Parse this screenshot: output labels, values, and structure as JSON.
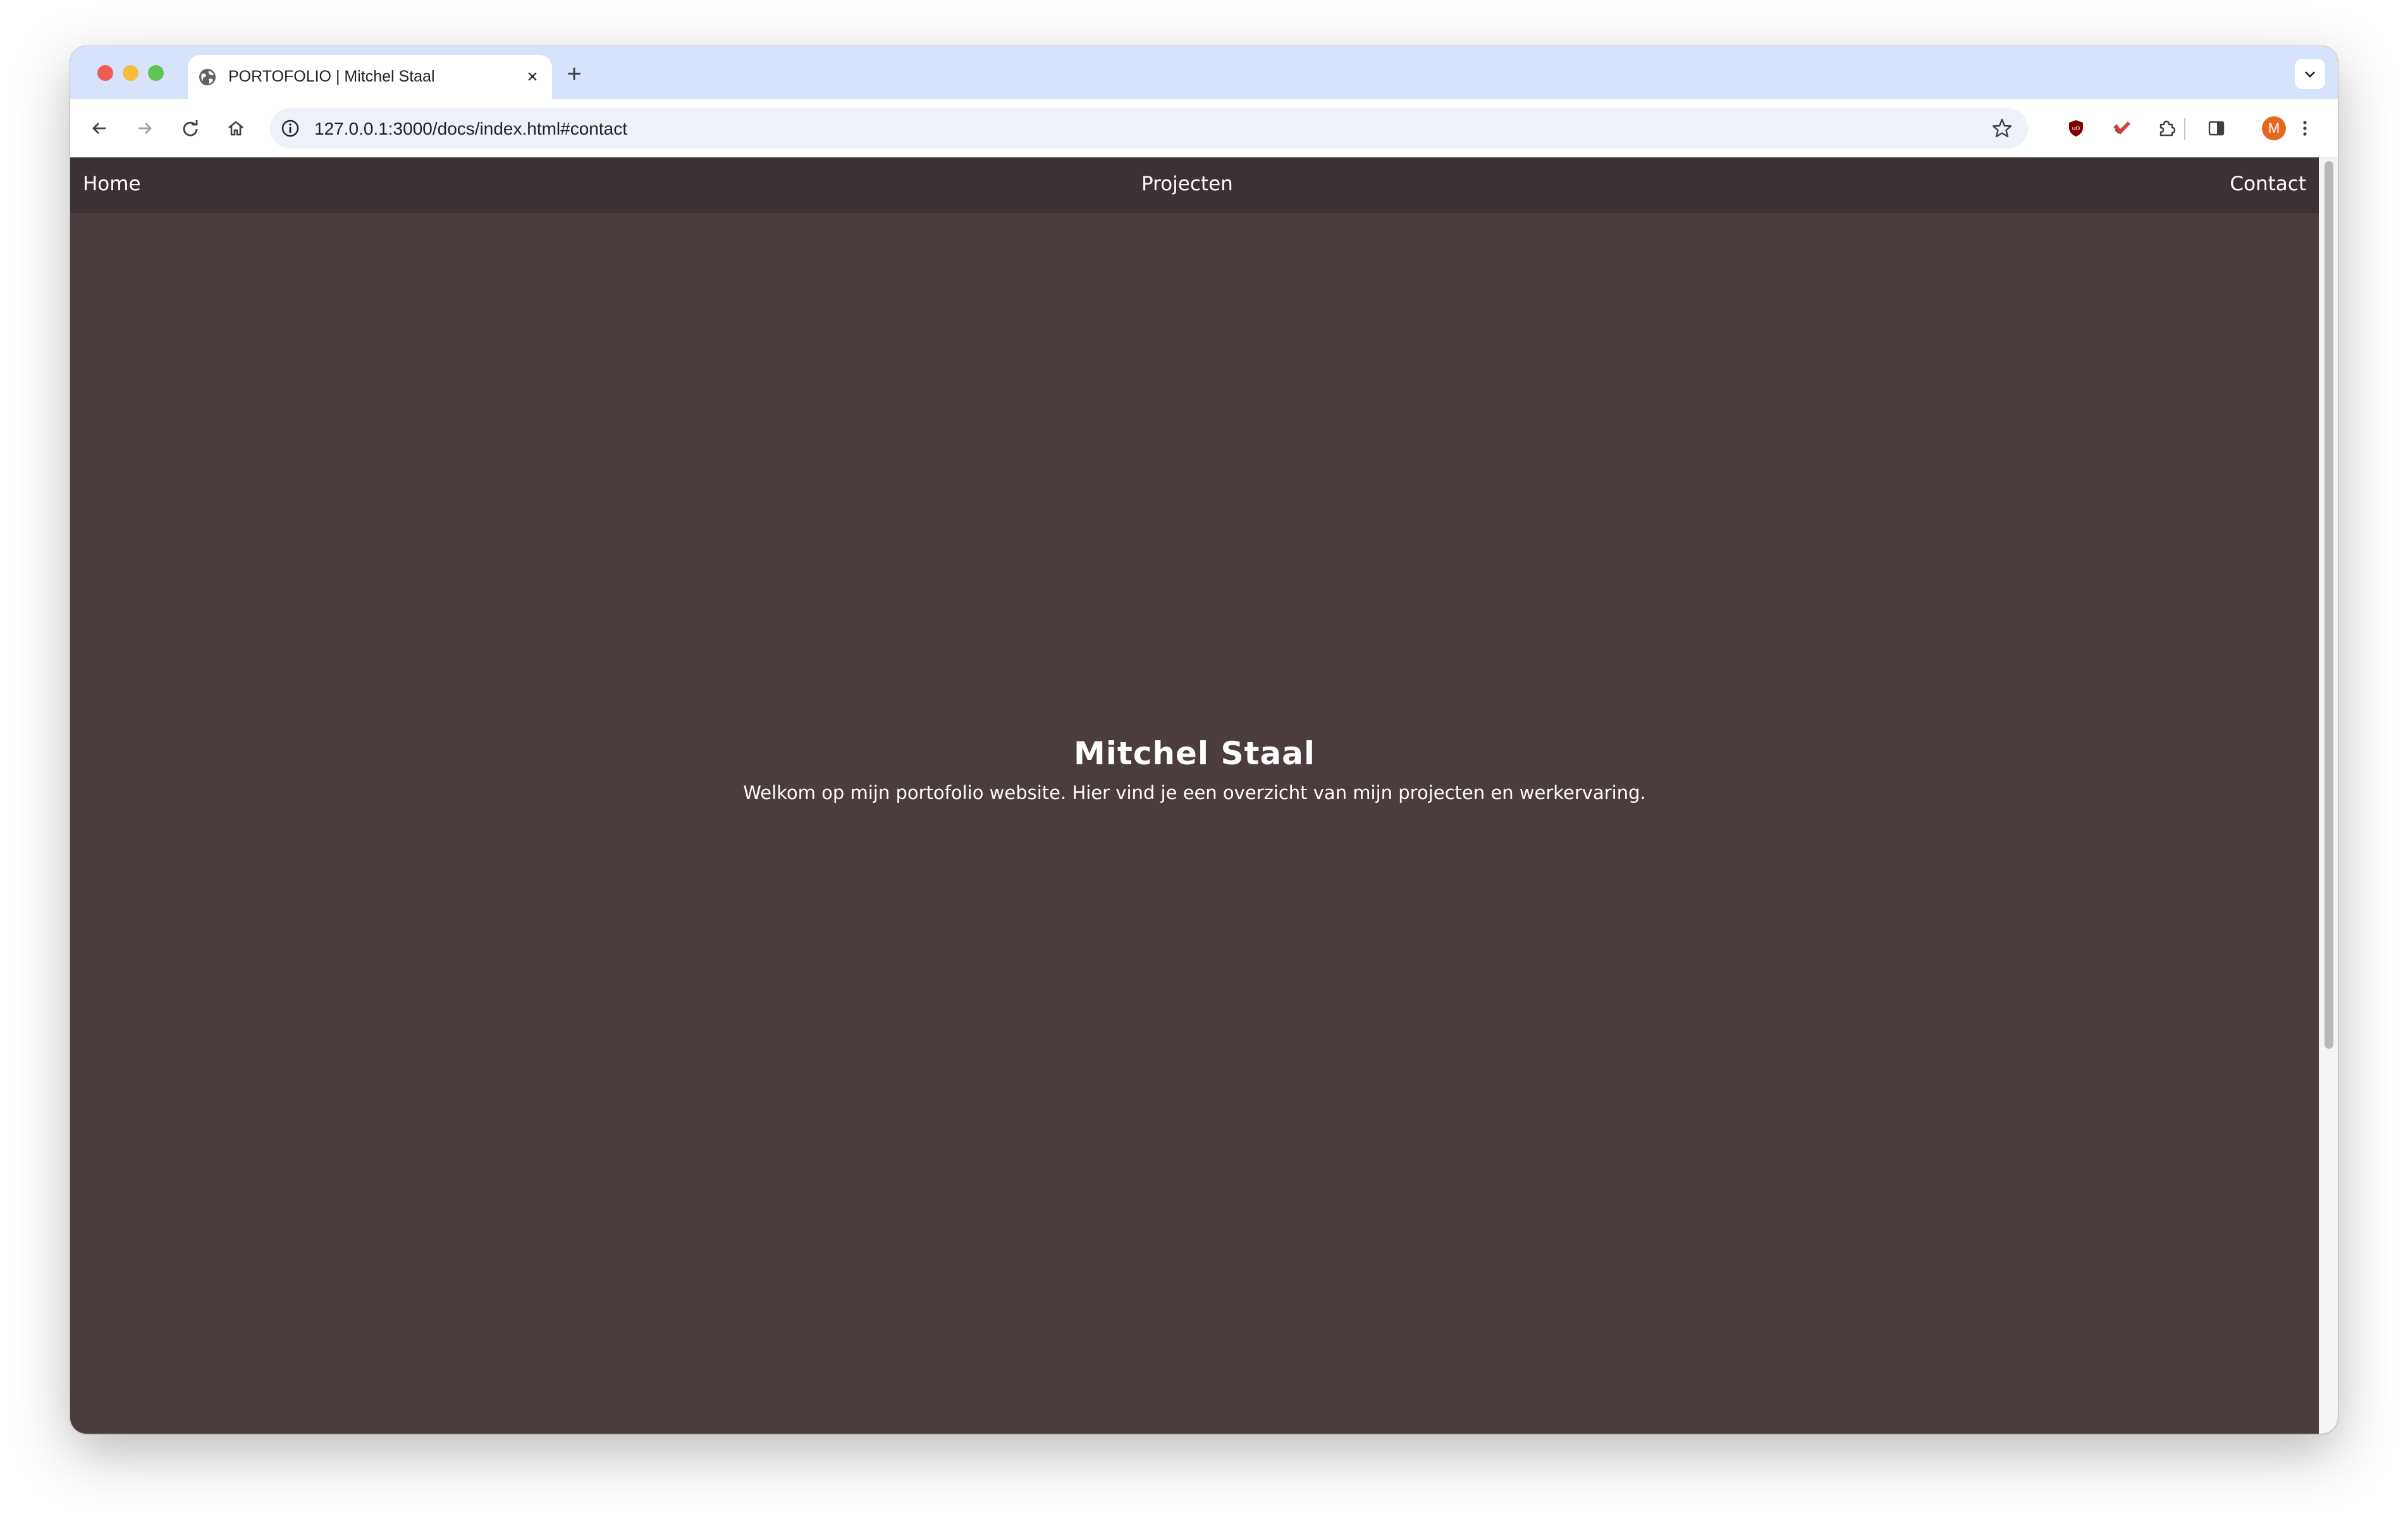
{
  "browser": {
    "tab": {
      "title": "PORTOFOLIO | Mitchel Staal",
      "close": "×"
    },
    "new_tab": "+",
    "url": "127.0.0.1:3000/docs/index.html#contact",
    "profile_initial": "M",
    "extension_icons": [
      "ublock-icon",
      "todo-check-icon",
      "puzzle-extensions-icon"
    ]
  },
  "site": {
    "nav": {
      "home": "Home",
      "projects": "Projecten",
      "contact": "Contact"
    },
    "hero": {
      "title": "Mitchel Staal",
      "subtitle": "Welkom op mijn portofolio website. Hier vind je een overzicht van mijn projecten en werkervaring."
    }
  },
  "colors": {
    "page_background": "#4b3c3d",
    "nav_background": "#3d3233",
    "text": "#ffffff",
    "tabstrip": "#d7e3fa",
    "avatar": "#e2691f"
  }
}
